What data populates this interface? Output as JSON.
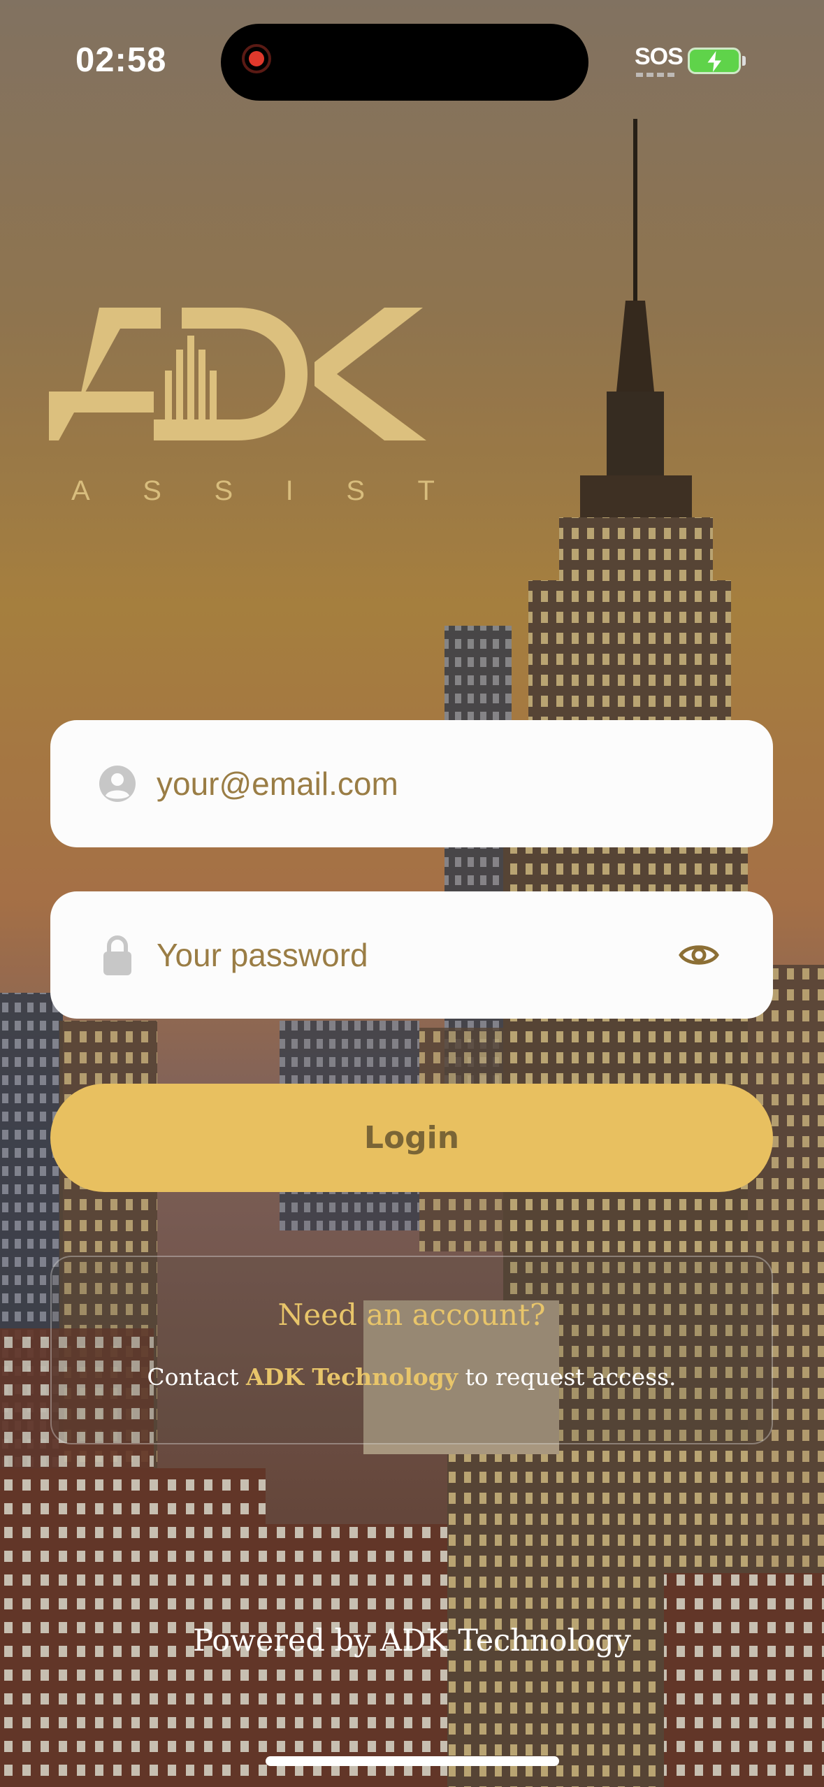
{
  "status_bar": {
    "time": "02:58",
    "sos": "SOS"
  },
  "logo": {
    "wordmark": "ADK",
    "tagline": [
      "A",
      "S",
      "S",
      "I",
      "S",
      "T"
    ]
  },
  "login_form": {
    "email_placeholder": "your@email.com",
    "password_placeholder": "Your password",
    "login_label": "Login"
  },
  "account_card": {
    "title": "Need an account?",
    "text_prefix": "Contact ",
    "brand": "ADK Technology",
    "text_suffix": " to request access."
  },
  "footer": {
    "powered_by": "Powered by ADK Technology"
  },
  "colors": {
    "gold": "#e8c060",
    "accent_text": "#e8c56a",
    "field_text": "#9a7d45"
  }
}
